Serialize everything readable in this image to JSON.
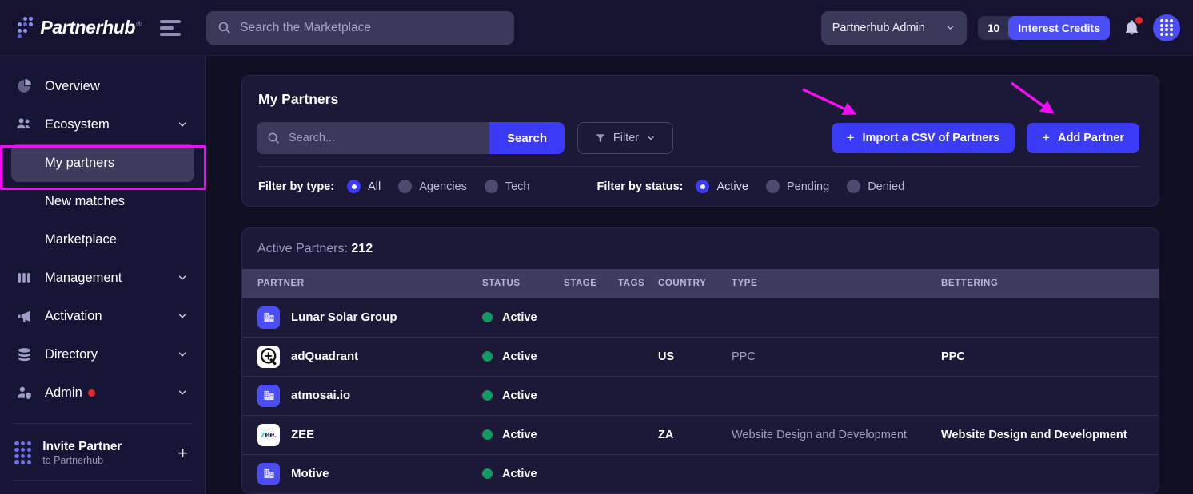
{
  "header": {
    "brand_name": "Partnerhub",
    "brand_registered": "®",
    "logo_icon": "partnerhub-dotmark-logo",
    "menu_icon": "hamburger-menu-icon",
    "search": {
      "placeholder": "Search the Marketplace",
      "value": "",
      "icon": "search-icon"
    },
    "admin_select": {
      "label": "Partnerhub Admin",
      "chevron": "chevron-down-icon"
    },
    "credits": {
      "count": "10",
      "label": "Interest Credits"
    },
    "notifications": {
      "icon": "bell-icon",
      "has_unread": true
    },
    "avatar": {
      "icon": "avatar-dotmark-icon"
    }
  },
  "sidebar": {
    "items": [
      {
        "label": "Overview",
        "icon": "pie-chart-icon",
        "expandable": false
      },
      {
        "label": "Ecosystem",
        "icon": "users-icon",
        "expandable": true
      },
      {
        "label": "Management",
        "icon": "columns-icon",
        "expandable": true
      },
      {
        "label": "Activation",
        "icon": "megaphone-icon",
        "expandable": true
      },
      {
        "label": "Directory",
        "icon": "database-icon",
        "expandable": true
      },
      {
        "label": "Admin",
        "icon": "user-shield-icon",
        "expandable": true,
        "badge": true
      }
    ],
    "sub_items": [
      {
        "label": "My partners",
        "active": true
      },
      {
        "label": "New matches",
        "active": false
      },
      {
        "label": "Marketplace",
        "active": false
      }
    ],
    "invite": {
      "title": "Invite Partner",
      "subtitle": "to Partnerhub",
      "icon": "partnerhub-dotmark-logo",
      "action_icon": "plus-icon"
    }
  },
  "panel": {
    "title": "My Partners",
    "search": {
      "placeholder": "Search...",
      "value": "",
      "icon": "search-icon"
    },
    "search_button": "Search",
    "filter_button": {
      "label": "Filter",
      "icon": "funnel-icon",
      "chevron": "chevron-down-icon"
    },
    "import_button": "Import a CSV of Partners",
    "add_button": "Add Partner",
    "filter_type": {
      "label": "Filter by type:",
      "options": [
        {
          "label": "All",
          "selected": true
        },
        {
          "label": "Agencies",
          "selected": false
        },
        {
          "label": "Tech",
          "selected": false
        }
      ]
    },
    "filter_status": {
      "label": "Filter by status:",
      "options": [
        {
          "label": "Active",
          "selected": true
        },
        {
          "label": "Pending",
          "selected": false
        },
        {
          "label": "Denied",
          "selected": false
        }
      ]
    }
  },
  "table": {
    "count_label": "Active Partners:",
    "count_value": "212",
    "columns": [
      "PARTNER",
      "STATUS",
      "STAGE",
      "TAGS",
      "COUNTRY",
      "TYPE",
      "BETTERING"
    ],
    "rows": [
      {
        "partner": "Lunar Solar Group",
        "logo": "building-icon",
        "status": "Active",
        "stage": "",
        "tags": "",
        "country": "",
        "type": "",
        "bettering": ""
      },
      {
        "partner": "adQuadrant",
        "logo": "circle-plus-icon",
        "status": "Active",
        "stage": "",
        "tags": "",
        "country": "US",
        "type": "PPC",
        "bettering": "PPC"
      },
      {
        "partner": "atmosai.io",
        "logo": "building-icon",
        "status": "Active",
        "stage": "",
        "tags": "",
        "country": "",
        "type": "",
        "bettering": ""
      },
      {
        "partner": "ZEE",
        "logo": "zee-wordmark-icon",
        "status": "Active",
        "stage": "",
        "tags": "",
        "country": "ZA",
        "type": "Website Design and Development",
        "bettering": "Website Design and Development"
      },
      {
        "partner": "Motive",
        "logo": "building-icon",
        "status": "Active",
        "stage": "",
        "tags": "",
        "country": "",
        "type": "",
        "bettering": ""
      }
    ]
  },
  "annotations": {
    "arrow_color": "#f30df3",
    "highlight_color": "#f30df3"
  },
  "colors": {
    "accent": "#3b3bf6",
    "page_bg": "#110f22",
    "card_bg": "#1b1838",
    "sidebar_bg": "#171535",
    "status_green": "#129a62",
    "alert_red": "#e8262c"
  }
}
